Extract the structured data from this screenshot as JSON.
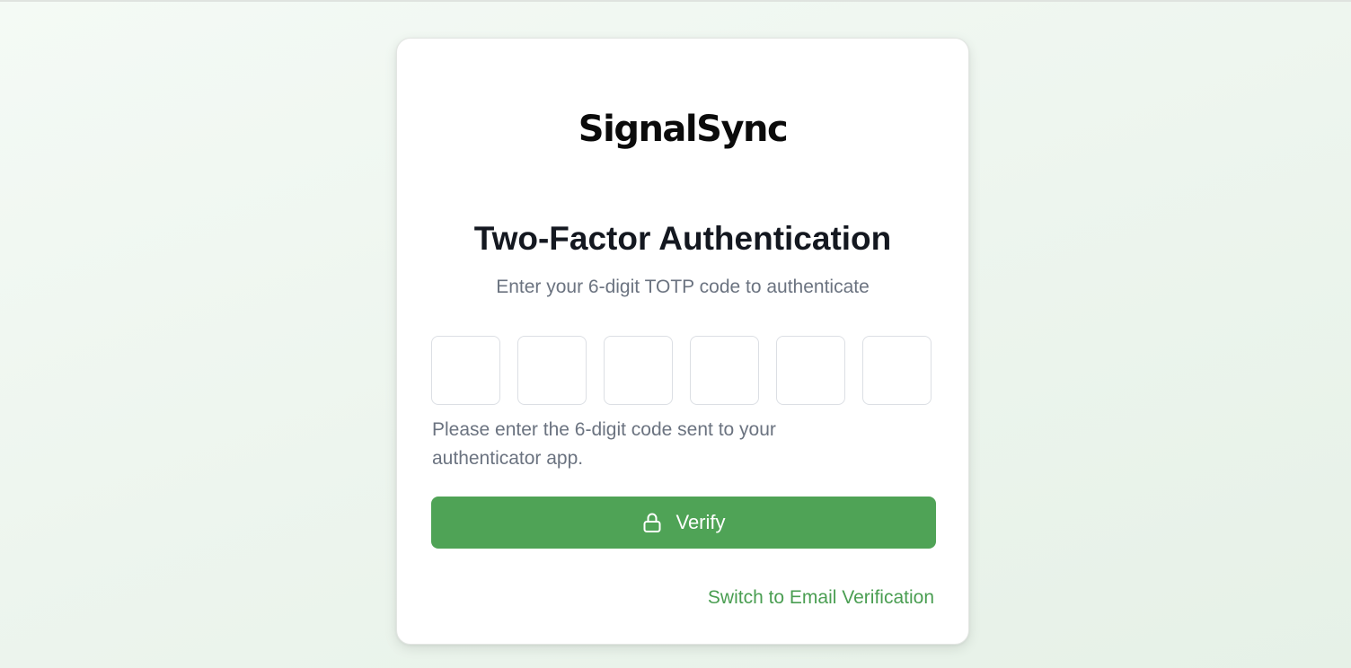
{
  "brand": {
    "logo_text": "SignalSync"
  },
  "auth": {
    "title": "Two-Factor Authentication",
    "subtitle": "Enter your 6-digit TOTP code to authenticate",
    "code_digits": [
      "",
      "",
      "",
      "",
      "",
      ""
    ],
    "hint": "Please enter the 6-digit code sent to your authenticator app.",
    "verify_label": "Verify",
    "verify_icon": "lock-icon",
    "switch_label": "Switch to Email Verification"
  },
  "colors": {
    "accent": "#4fa356",
    "link": "#4a9e52",
    "title": "#141820",
    "muted_text": "#6b7380",
    "background": "#edf5ee"
  }
}
